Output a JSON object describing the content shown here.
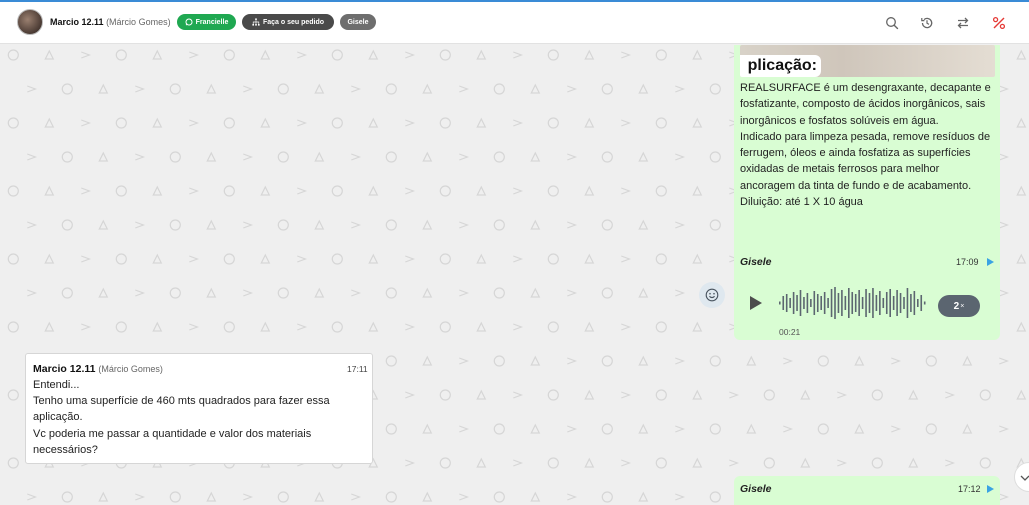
{
  "header": {
    "contact_name": "Marcio 12.11",
    "contact_sub": "(Márcio Gomes)",
    "tags": [
      {
        "label": "Francielle",
        "color": "#1fa851",
        "icon": "whatsapp-icon"
      },
      {
        "label": "Faça o seu pedido",
        "color": "#4a4a4a",
        "icon": "sitemap-icon"
      },
      {
        "label": "Gisele",
        "color": "#6e6e6e"
      }
    ],
    "icons": [
      "search-icon",
      "history-icon",
      "transfer-icon",
      "percent-icon"
    ]
  },
  "messages": {
    "m1": {
      "image_label": "plicação:",
      "text": "REALSURFACE é um desengraxante, decapante e fosfatizante, composto de ácidos inorgânicos, sais inorgânicos e fosfatos solúveis em água.\nIndicado para limpeza pesada, remove resíduos de ferrugem, óleos e ainda fosfatiza as superfícies oxidadas de metais ferrosos para melhor ancoragem da tinta de fundo e de acabamento.\nDiluição: até 1 X 10 água"
    },
    "m2": {
      "sender": "Gisele",
      "time": "17:09",
      "duration": "00:21",
      "speed": "2",
      "speed_suffix": "×"
    },
    "m3": {
      "sender_name": "Marcio 12.11",
      "sender_sub": "(Márcio Gomes)",
      "time": "17:11",
      "text": "Entendi...\nTenho uma superfície de 460 mts quadrados para fazer essa aplicação.\nVc poderia me passar a quantidade e valor dos materiais necessários?"
    },
    "m4": {
      "sender": "Gisele",
      "time": "17:12"
    }
  },
  "colors": {
    "bubble_out": "#d9fdd3",
    "bubble_in": "#ffffff",
    "chat_bg": "#efefef",
    "accent_blue": "#3aa3e3"
  }
}
